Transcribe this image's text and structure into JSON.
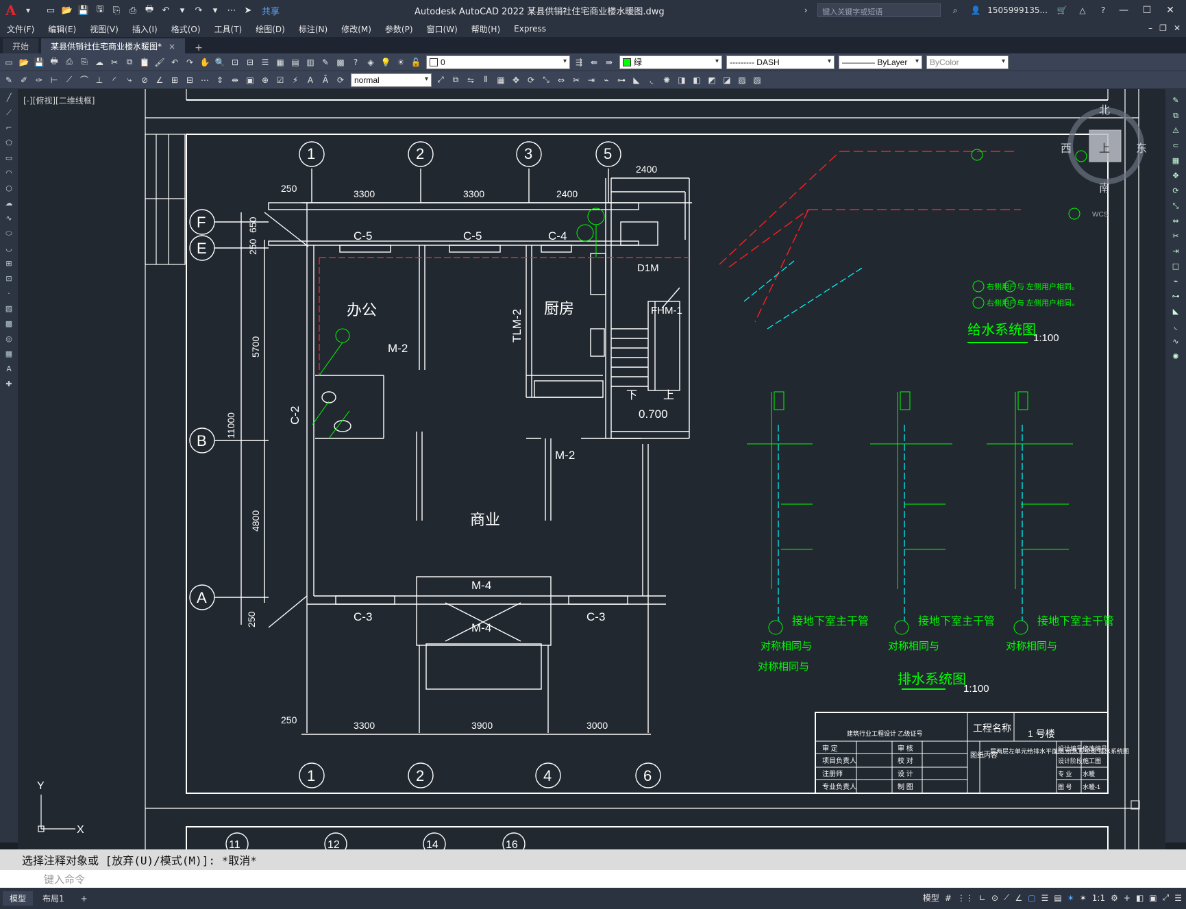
{
  "app": {
    "logo": "A",
    "title": "Autodesk AutoCAD 2022    某县供销社住宅商业楼水暖图.dwg",
    "share_label": "共享",
    "search_placeholder": "键入关键字或短语",
    "user": "1505999135...",
    "help": "?"
  },
  "menu": [
    "文件(F)",
    "编辑(E)",
    "视图(V)",
    "插入(I)",
    "格式(O)",
    "工具(T)",
    "绘图(D)",
    "标注(N)",
    "修改(M)",
    "参数(P)",
    "窗口(W)",
    "帮助(H)",
    "Express"
  ],
  "tabs": {
    "start": "开始",
    "active": "某县供销社住宅商业楼水暖图*",
    "close": "×",
    "add": "+"
  },
  "toolbar": {
    "layer_value": "0",
    "color_value": "绿",
    "linetype_value": "--------- DASH",
    "lineweight_value": "———— ByLayer",
    "plotstyle_value": "ByColor",
    "textstyle_value": "normal"
  },
  "viewport": {
    "label": "[-][俯视][二维线框]"
  },
  "viewcube": {
    "north": "北",
    "south": "南",
    "east": "东",
    "west": "西",
    "top": "上",
    "wcs": "WCS"
  },
  "ucs": {
    "x": "X",
    "y": "Y"
  },
  "drawing": {
    "grid_top": [
      "1",
      "2",
      "3",
      "5"
    ],
    "grid_bottom": [
      "1",
      "2",
      "4",
      "6"
    ],
    "grid_left": [
      "F",
      "E",
      "B",
      "A"
    ],
    "grid_bottom_partial": [
      "11",
      "12",
      "14",
      "16"
    ],
    "dims_top": [
      "250",
      "3300",
      "3300",
      "2400",
      "2400"
    ],
    "dims_bottom": [
      "250",
      "3300",
      "3900",
      "3000"
    ],
    "dims_left": [
      "650",
      "250",
      "5700",
      "11000",
      "4800",
      "250"
    ],
    "rooms": [
      "办公",
      "厨房",
      "商业"
    ],
    "labels": [
      "C-5",
      "C-5",
      "C-4",
      "C-3",
      "C-3",
      "C-2",
      "M-2",
      "M-2",
      "M-4",
      "M-4",
      "TLM-2",
      "FHM-1",
      "D1M",
      "下",
      "上",
      "0.700"
    ],
    "water_title": "给水系统图",
    "water_scale": "1:100",
    "drain_title": "排水系统图",
    "drain_scale": "1:100",
    "drain_notes": [
      "接地下室主干管",
      "接地下室主干管",
      "接地下室主干管"
    ],
    "sym_notes": [
      "对称相同与",
      "对称相同与",
      "对称相同与",
      "对称相同与"
    ],
    "legend_notes": [
      "右侧用户与 左侧用户相同。",
      "右侧用户与 左侧用户相同。"
    ],
    "titleblock": {
      "project_label": "工程名称",
      "project_value": "1 号楼",
      "contents": "一层两层左单元给排水平面图\n给水系统图\n排水系统图",
      "roles": [
        "审  定",
        "项目负责人",
        "注册师",
        "专业负责人"
      ],
      "checks": [
        "审 核",
        "校 对",
        "设 计",
        "制 图"
      ],
      "meta_labels": [
        "设计编号",
        "设计阶段",
        "专 业",
        "图 号"
      ],
      "meta_values": [
        "修改编号",
        "施工图",
        "水暖",
        "水暖-1"
      ],
      "contents_label": "图纸内容",
      "org": "建筑行业工程设计  乙级证号"
    }
  },
  "command": {
    "history": "选择注释对象或 [放弃(U)/模式(M)]: *取消*",
    "placeholder": "键入命令"
  },
  "status": {
    "tabs": [
      "模型",
      "布局1"
    ],
    "add": "+",
    "model_label": "模型",
    "scale": "1:1"
  },
  "colors": {
    "accent": "#5fa8ff",
    "cad_green": "#00ff00",
    "cad_red": "#ff2020",
    "cad_cyan": "#00ffff",
    "cad_white": "#ffffff",
    "canvas": "#212830"
  }
}
